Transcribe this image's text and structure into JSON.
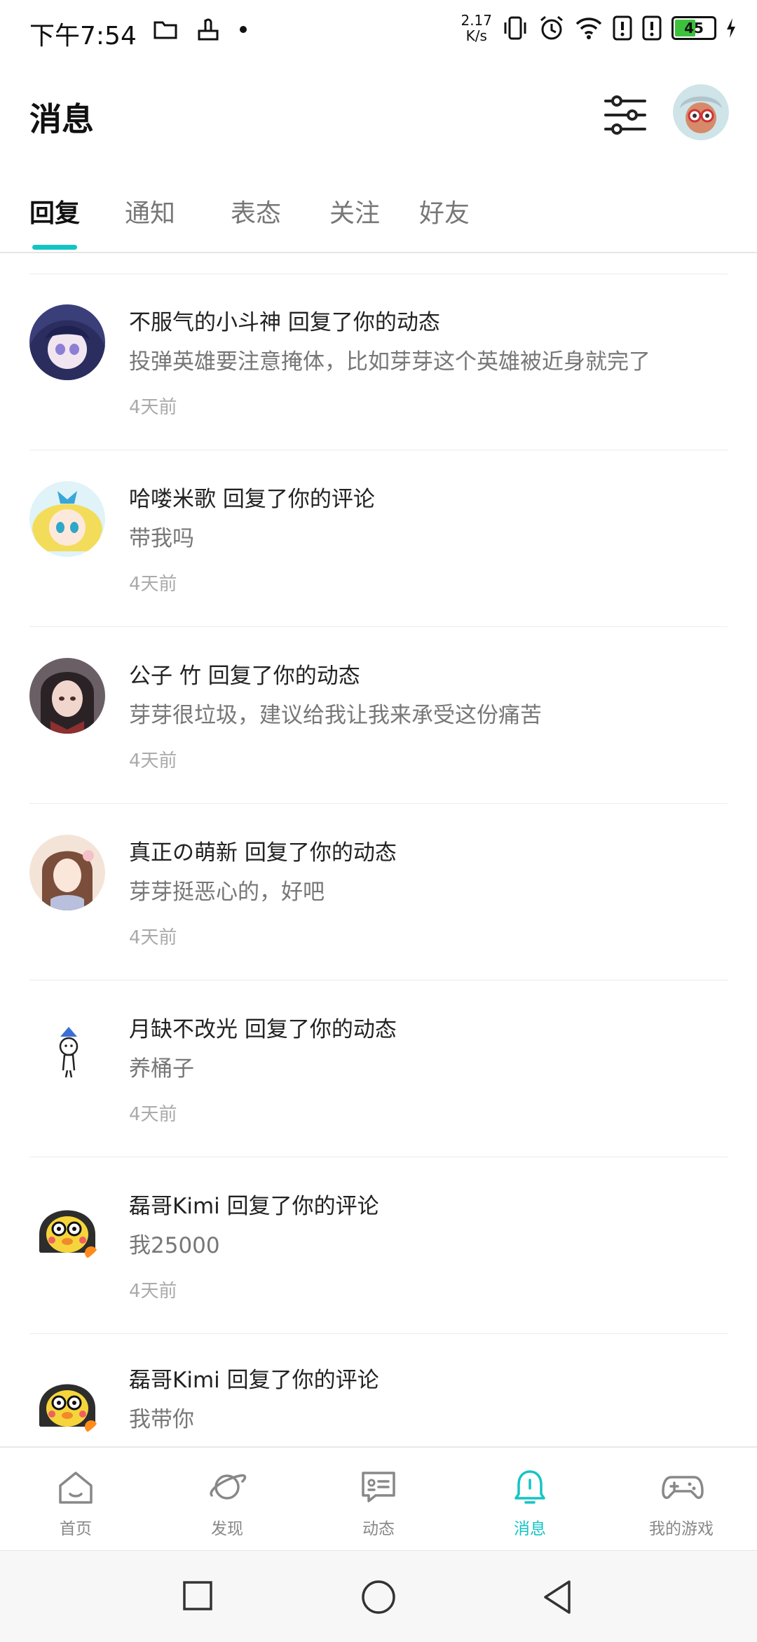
{
  "status_bar": {
    "time": "下午7:54",
    "net_speed_value": "2.17",
    "net_speed_unit": "K/s",
    "battery_level": "45",
    "icons": [
      "folder-icon",
      "hand-icon",
      "dot-icon",
      "vibrate-icon",
      "alarm-icon",
      "wifi-icon",
      "alert-icon",
      "alert-icon",
      "battery-icon",
      "charging-icon"
    ]
  },
  "header": {
    "title": "消息",
    "filter_icon": "sliders-icon"
  },
  "tabs": [
    {
      "label": "回复",
      "active": true
    },
    {
      "label": "通知",
      "active": false
    },
    {
      "label": "表态",
      "active": false
    },
    {
      "label": "关注",
      "active": false
    },
    {
      "label": "好友",
      "active": false
    }
  ],
  "messages": [
    {
      "title": "不服气的小斗神 回复了你的动态",
      "content": "投弹英雄要注意掩体，比如芽芽这个英雄被近身就完了",
      "time": "4天前"
    },
    {
      "title": "哈喽米歌 回复了你的评论",
      "content": "带我吗",
      "time": "4天前"
    },
    {
      "title": "公子 竹 回复了你的动态",
      "content": "芽芽很垃圾，建议给我让我来承受这份痛苦",
      "time": "4天前"
    },
    {
      "title": "真正の萌新 回复了你的动态",
      "content": "芽芽挺恶心的，好吧",
      "time": "4天前"
    },
    {
      "title": "月缺不改光 回复了你的动态",
      "content": "养桶子",
      "time": "4天前"
    },
    {
      "title": "磊哥Kimi 回复了你的评论",
      "content": "我25000",
      "time": "4天前"
    },
    {
      "title": "磊哥Kimi 回复了你的评论",
      "content": "我带你",
      "time": ""
    }
  ],
  "bottom_nav": [
    {
      "label": "首页",
      "icon": "home-icon",
      "active": false
    },
    {
      "label": "发现",
      "icon": "planet-icon",
      "active": false
    },
    {
      "label": "动态",
      "icon": "feed-icon",
      "active": false
    },
    {
      "label": "消息",
      "icon": "bell-icon",
      "active": true
    },
    {
      "label": "我的游戏",
      "icon": "gamepad-icon",
      "active": false
    }
  ],
  "system_nav": [
    "recents-button",
    "home-button",
    "back-button"
  ],
  "colors": {
    "accent": "#14c4c4",
    "text_primary": "#222222",
    "text_secondary": "#777777",
    "text_muted": "#aaaaaa"
  }
}
